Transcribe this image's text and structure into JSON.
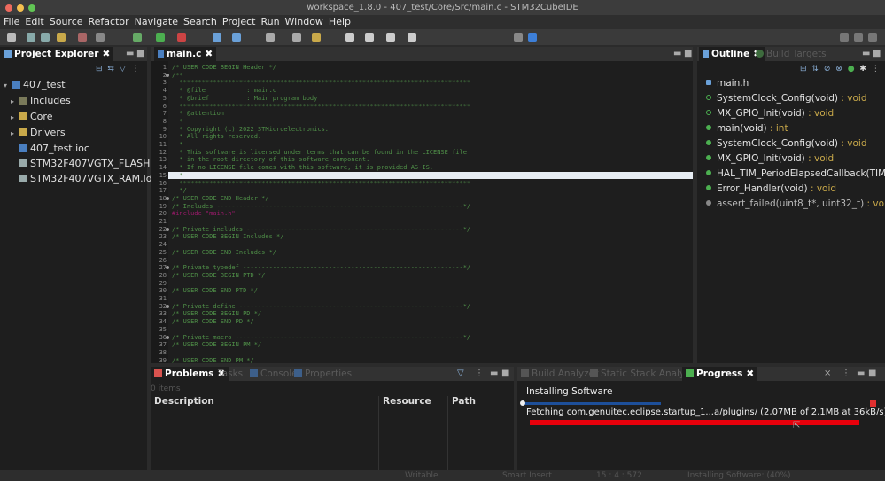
{
  "window": {
    "title": "workspace_1.8.0 - 407_test/Core/Src/main.c - STM32CubeIDE"
  },
  "menu": [
    "File",
    "Edit",
    "Source",
    "Refactor",
    "Navigate",
    "Search",
    "Project",
    "Run",
    "Window",
    "Help"
  ],
  "project_explorer": {
    "tab": "Project Explorer",
    "items": [
      {
        "label": "407_test",
        "expanded": true,
        "level": 0,
        "icon": "project-icon"
      },
      {
        "label": "Includes",
        "level": 1,
        "icon": "includes-icon"
      },
      {
        "label": "Core",
        "level": 1,
        "icon": "folder-icon"
      },
      {
        "label": "Drivers",
        "level": 1,
        "icon": "folder-icon"
      },
      {
        "label": "407_test.ioc",
        "level": 1,
        "icon": "ioc-file-icon"
      },
      {
        "label": "STM32F407VGTX_FLASH.ld",
        "level": 1,
        "icon": "linker-file-icon"
      },
      {
        "label": "STM32F407VGTX_RAM.ld",
        "level": 1,
        "icon": "linker-file-icon"
      }
    ]
  },
  "editor": {
    "tab": "main.c",
    "highlight_line": 15,
    "lines": [
      "/* USER CODE BEGIN Header */",
      "/**",
      "  ******************************************************************************",
      "  * @file           : main.c",
      "  * @brief          : Main program body",
      "  ******************************************************************************",
      "  * @attention",
      "  *",
      "  * Copyright (c) 2022 STMicroelectronics.",
      "  * All rights reserved.",
      "  *",
      "  * This software is licensed under terms that can be found in the LICENSE file",
      "  * in the root directory of this software component.",
      "  * If no LICENSE file comes with this software, it is provided AS-IS.",
      "  *",
      "  ******************************************************************************",
      "  */",
      "/* USER CODE END Header */",
      "/* Includes ------------------------------------------------------------------*/",
      "#include \"main.h\"",
      "",
      "/* Private includes ----------------------------------------------------------*/",
      "/* USER CODE BEGIN Includes */",
      "",
      "/* USER CODE END Includes */",
      "",
      "/* Private typedef -----------------------------------------------------------*/",
      "/* USER CODE BEGIN PTD */",
      "",
      "/* USER CODE END PTD */",
      "",
      "/* Private define ------------------------------------------------------------*/",
      "/* USER CODE BEGIN PD */",
      "/* USER CODE END PD */",
      "",
      "/* Private macro -------------------------------------------------------------*/",
      "/* USER CODE BEGIN PM */",
      "",
      "/* USER CODE END PM */"
    ]
  },
  "outline": {
    "tab": "Outline",
    "tab2": "Build Targets",
    "items": [
      {
        "name": "main.h",
        "type": "",
        "icon": "include-icon"
      },
      {
        "name": "SystemClock_Config(void)",
        "type": " : void",
        "icon": "function-declaration-icon"
      },
      {
        "name": "MX_GPIO_Init(void)",
        "type": " : void",
        "icon": "static-function-declaration-icon"
      },
      {
        "name": "main(void)",
        "type": " : int",
        "icon": "function-icon"
      },
      {
        "name": "SystemClock_Config(void)",
        "type": " : void",
        "icon": "function-icon"
      },
      {
        "name": "MX_GPIO_Init(void)",
        "type": " : void",
        "icon": "static-function-icon"
      },
      {
        "name": "HAL_TIM_PeriodElapsedCallback(TIM_Ha",
        "type": "",
        "icon": "function-icon"
      },
      {
        "name": "Error_Handler(void)",
        "type": " : void",
        "icon": "function-icon"
      },
      {
        "name": "assert_failed(uint8_t*, uint32_t)",
        "type": " : void",
        "icon": "inactive-function-icon"
      }
    ]
  },
  "problems": {
    "tabs": [
      "Problems",
      "Tasks",
      "Console",
      "Properties"
    ],
    "summary": "0 items",
    "columns": [
      "Description",
      "Resource",
      "Path"
    ]
  },
  "progress": {
    "tabs": [
      "Build Analyzer",
      "Static Stack Analyzer",
      "Progress"
    ],
    "job": "Installing Software",
    "detail": "Fetching com.genuitec.eclipse.startup_1...a/plugins/ (2,07MB of 2,1MB at 36kB/s)",
    "bar_fraction": 0.4
  },
  "status": {
    "writable": "Writable",
    "insert": "Smart Insert",
    "position": "15 : 4 : 572",
    "task": "Installing Software: (40%)"
  },
  "colors": {
    "accent_red": "#e8000b",
    "progress_blue": "#1d4f9a"
  }
}
